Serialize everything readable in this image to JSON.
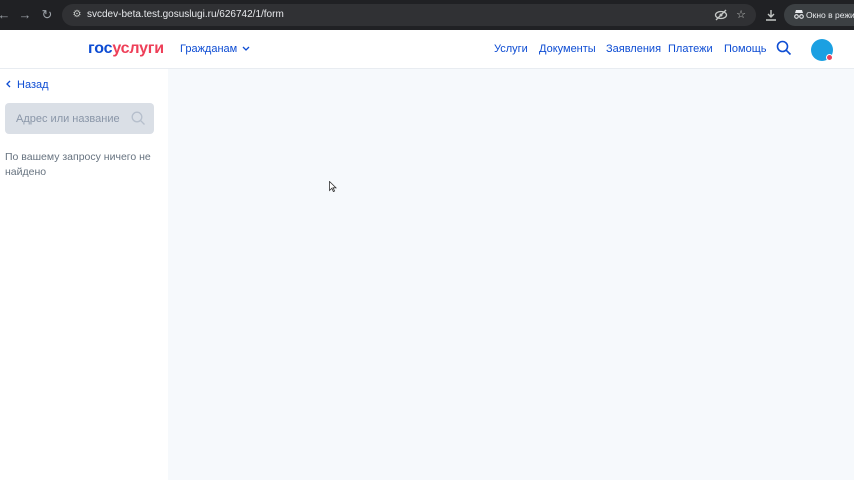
{
  "browser": {
    "url": "svcdev-beta.test.gosuslugi.ru/626742/1/form",
    "incognito_label": "Окно в режим",
    "icons": {
      "back": "back-arrow-icon",
      "forward": "forward-arrow-icon",
      "reload": "reload-icon",
      "site_info": "tune-icon",
      "eye_off": "eye-off-icon",
      "bookmark": "star-icon",
      "download": "download-icon",
      "incognito": "incognito-icon"
    }
  },
  "header": {
    "logo_part1": "гос",
    "logo_part2": "услуги",
    "audience_label": "Гражданам",
    "nav": [
      {
        "label": "Услуги"
      },
      {
        "label": "Документы"
      },
      {
        "label": "Заявления"
      },
      {
        "label": "Платежи"
      },
      {
        "label": "Помощь"
      }
    ],
    "colors": {
      "brand_blue": "#0d4cd3",
      "brand_red": "#ee3f58",
      "avatar": "#1ba0e2"
    }
  },
  "sidebar": {
    "back_label": "Назад",
    "search_placeholder": "Адрес или название",
    "empty_message": "По вашему запросу ничего не найдено"
  }
}
